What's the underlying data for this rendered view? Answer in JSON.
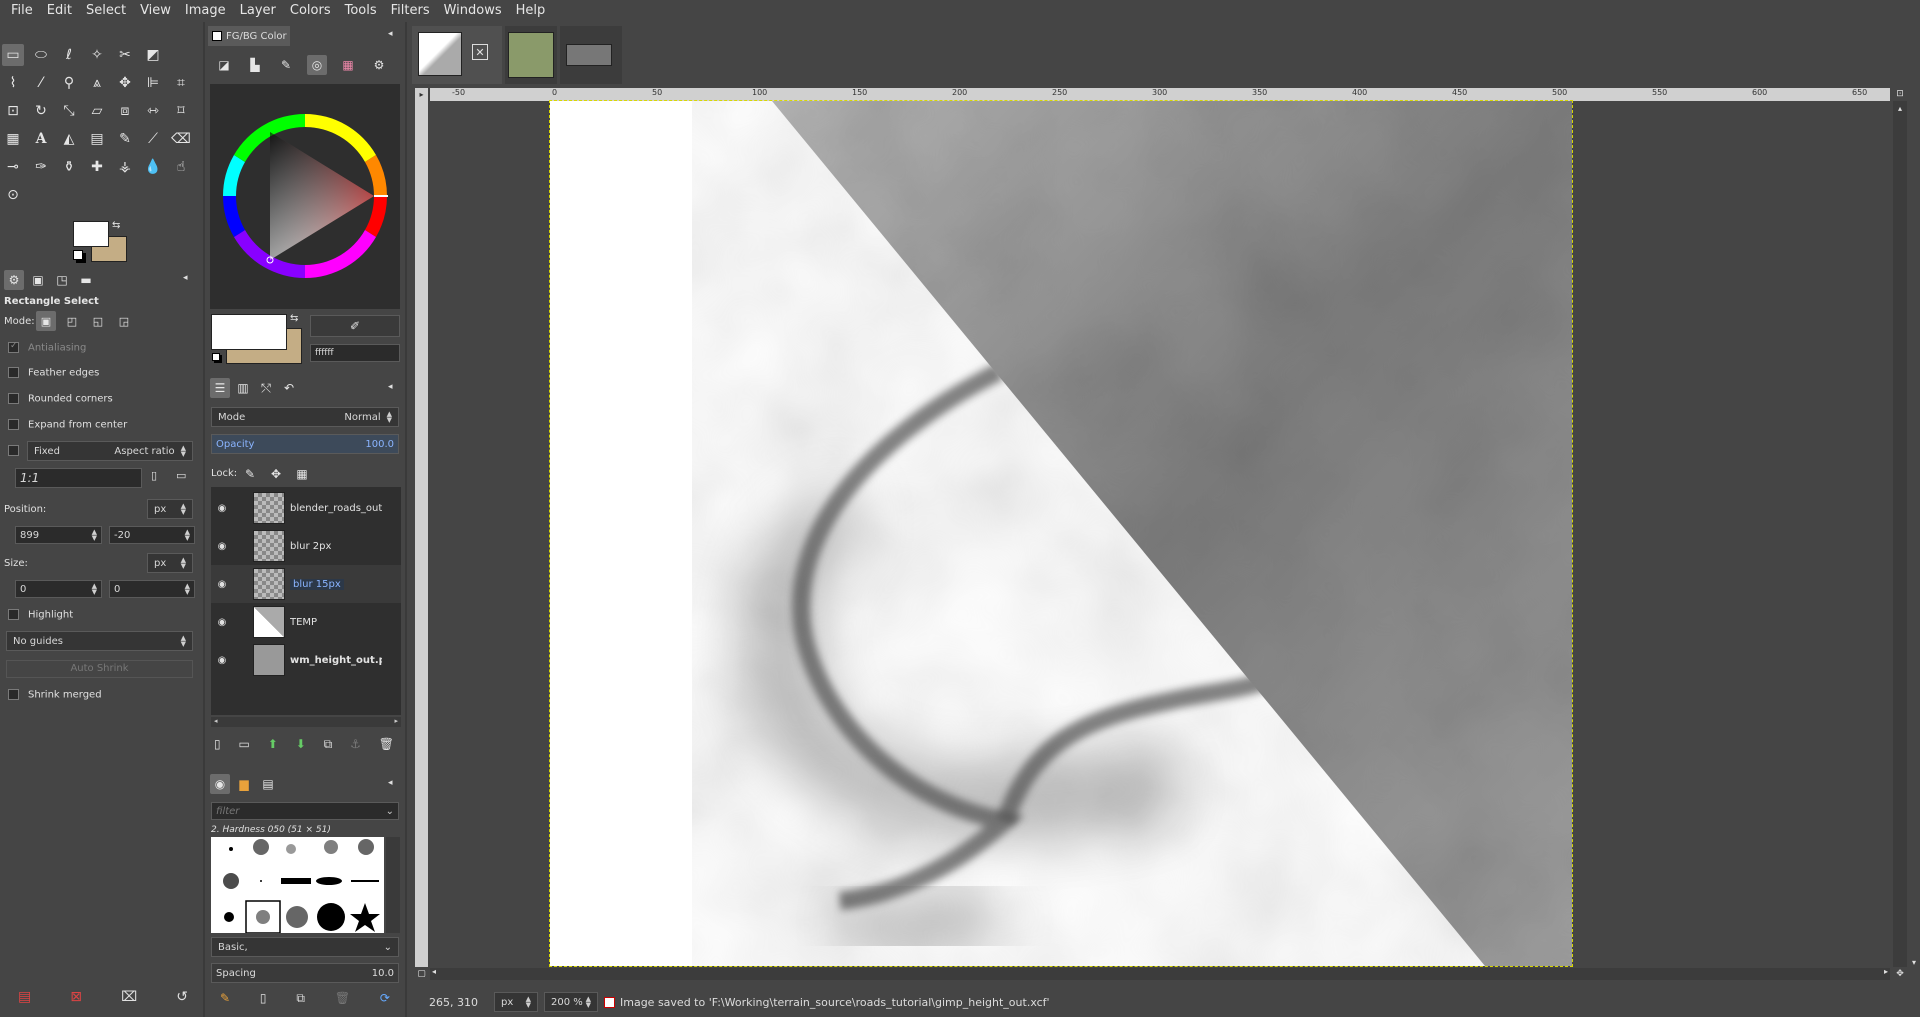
{
  "menubar": [
    "File",
    "Edit",
    "Select",
    "View",
    "Image",
    "Layer",
    "Colors",
    "Tools",
    "Filters",
    "Windows",
    "Help"
  ],
  "tool_options": {
    "title": "Rectangle Select",
    "mode_label": "Mode:",
    "antialiasing": "Antialiasing",
    "feather_edges": "Feather edges",
    "rounded_corners": "Rounded corners",
    "expand_from_center": "Expand from center",
    "fixed_label": "Fixed",
    "fixed_value": "Aspect ratio",
    "ratio": "1:1",
    "position_label": "Position:",
    "position_unit": "px",
    "position_x": "899",
    "position_y": "-20",
    "size_label": "Size:",
    "size_unit": "px",
    "size_w": "0",
    "size_h": "0",
    "highlight": "Highlight",
    "guides": "No guides",
    "auto_shrink": "Auto Shrink",
    "shrink_merged": "Shrink merged"
  },
  "fgbg": {
    "tab_label": "FG/BG Color",
    "hex_value": "ffffff",
    "fg_color": "#ffffff",
    "bg_color": "#c4ad85"
  },
  "layers": {
    "mode_label": "Mode",
    "mode_value": "Normal",
    "opacity_label": "Opacity",
    "opacity_value": "100.0",
    "lock_label": "Lock:",
    "items": [
      {
        "name": "blender_roads_out.p",
        "bold": false,
        "selected": false
      },
      {
        "name": "blur 2px",
        "bold": false,
        "selected": false
      },
      {
        "name": "blur 15px",
        "bold": false,
        "selected": true
      },
      {
        "name": "TEMP",
        "bold": false,
        "selected": false
      },
      {
        "name": "wm_height_out.pn",
        "bold": true,
        "selected": false
      }
    ]
  },
  "brushes": {
    "filter_placeholder": "filter",
    "current": "2. Hardness 050 (51 × 51)",
    "preset": "Basic,",
    "spacing_label": "Spacing",
    "spacing_value": "10.0"
  },
  "ruler": {
    "h_labels": [
      "-50",
      "0",
      "50",
      "100",
      "150",
      "200",
      "250",
      "300",
      "350",
      "400",
      "450",
      "500",
      "550",
      "600",
      "650"
    ]
  },
  "status": {
    "coords": "265, 310",
    "unit": "px",
    "zoom": "200 %",
    "message": "Image saved to 'F:\\Working\\terrain_source\\roads_tutorial\\gimp_height_out.xcf'"
  }
}
